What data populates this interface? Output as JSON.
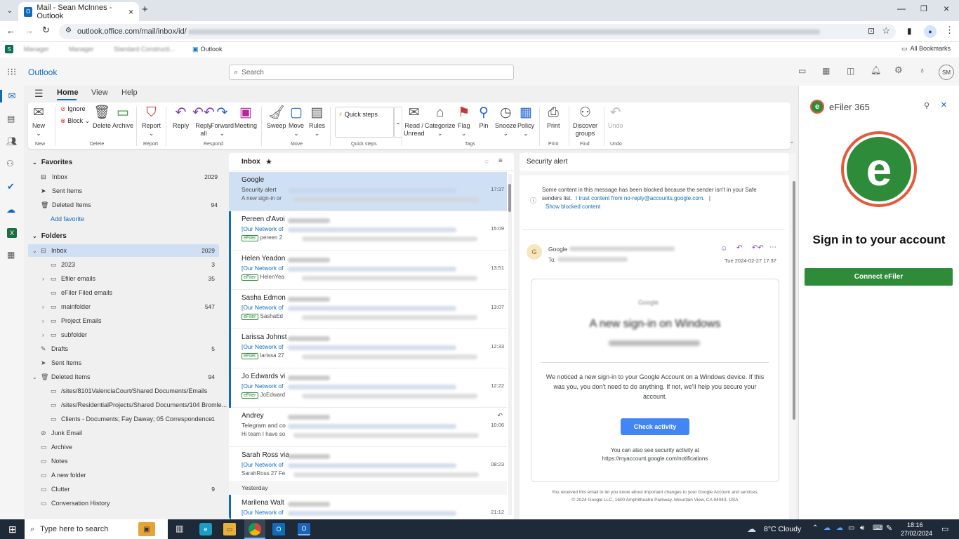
{
  "browser": {
    "tab_title": "Mail - Sean McInnes - Outlook",
    "url": "outlook.office.com/mail/inbox/id/",
    "bookmarks": [
      "Manager",
      "Manager",
      "Standard Constructi...",
      "Outlook"
    ],
    "all_bookmarks": "All Bookmarks",
    "profile_initials": "SM"
  },
  "app": {
    "name": "Outlook",
    "search_placeholder": "Search",
    "user_initials": "SM"
  },
  "ribbon": {
    "tabs": [
      "Home",
      "View",
      "Help"
    ],
    "buttons": {
      "new": "New",
      "ignore": "Ignore",
      "block": "Block",
      "delete": "Delete",
      "archive": "Archive",
      "report": "Report",
      "reply": "Reply",
      "reply_all_1": "Reply",
      "reply_all_2": "all",
      "forward": "Forward",
      "meeting": "Meeting",
      "sweep": "Sweep",
      "move": "Move",
      "rules": "Rules",
      "quick_steps": "Quick steps",
      "read_unread_1": "Read /",
      "read_unread_2": "Unread",
      "categorize": "Categorize",
      "flag": "Flag",
      "pin": "Pin",
      "snooze": "Snooze",
      "policy": "Policy",
      "print": "Print",
      "discover_1": "Discover",
      "discover_2": "groups",
      "undo": "Undo"
    },
    "groups": [
      "New",
      "Delete",
      "Report",
      "Respond",
      "Move",
      "Quick steps",
      "Tags",
      "Print",
      "Find",
      "Undo"
    ]
  },
  "folders": {
    "favorites_label": "Favorites",
    "favorites": [
      {
        "name": "Inbox",
        "count": "2029"
      },
      {
        "name": "Sent Items",
        "count": ""
      },
      {
        "name": "Deleted Items",
        "count": "94"
      }
    ],
    "add_favorite": "Add favorite",
    "folders_label": "Folders",
    "items": [
      {
        "name": "Inbox",
        "count": "2029"
      },
      {
        "name": "2023",
        "count": "3"
      },
      {
        "name": "Efiler emails",
        "count": "35"
      },
      {
        "name": "eFiler Filed emails",
        "count": ""
      },
      {
        "name": "mainfolder",
        "count": "547"
      },
      {
        "name": "Project Emails",
        "count": ""
      },
      {
        "name": "subfolder",
        "count": ""
      },
      {
        "name": "Drafts",
        "count": "5"
      },
      {
        "name": "Sent Items",
        "count": ""
      },
      {
        "name": "Deleted Items",
        "count": "94"
      },
      {
        "name": "/sites/8101ValenciaCourt/Shared Documents/Emails",
        "count": ""
      },
      {
        "name": "/sites/ResidentialProjects/Shared Documents/104 Bromle...",
        "count": ""
      },
      {
        "name": "Clients - Documents; Fay Daway; 05 Correspondence",
        "count": "1"
      },
      {
        "name": "Junk Email",
        "count": ""
      },
      {
        "name": "Archive",
        "count": ""
      },
      {
        "name": "Notes",
        "count": ""
      },
      {
        "name": "A new folder",
        "count": ""
      },
      {
        "name": "Clutter",
        "count": "9"
      },
      {
        "name": "Conversation History",
        "count": ""
      }
    ]
  },
  "message_list": {
    "title": "Inbox",
    "yesterday_label": "Yesterday",
    "messages": [
      {
        "sender": "Google",
        "subject": "Security alert",
        "preview": "A new sign-in or",
        "time": "17:37",
        "tag": ""
      },
      {
        "sender": "Pereen d'Avoi",
        "subject": "[Our Network of",
        "preview": "pereen 2",
        "time": "15:09",
        "tag": "eFiler"
      },
      {
        "sender": "Helen Yeadon",
        "subject": "[Our Network of",
        "preview": "HelenYea",
        "time": "13:51",
        "tag": "eFiler"
      },
      {
        "sender": "Sasha Edmon",
        "subject": "[Our Network of",
        "preview": "SashaEd",
        "time": "13:07",
        "tag": "eFiler"
      },
      {
        "sender": "Larissa Johnst",
        "subject": "[Our Network of",
        "preview": "larissa 27",
        "time": "12:33",
        "tag": "eFiler"
      },
      {
        "sender": "Jo Edwards vi",
        "subject": "[Our Network of",
        "preview": "JoEdward",
        "time": "12:22",
        "tag": "eFiler"
      },
      {
        "sender": "Andrey",
        "subject": "Telegram and co",
        "preview": "Hi team I have so",
        "time": "10:06",
        "tag": ""
      },
      {
        "sender": "Sarah Ross via",
        "subject": "[Our Network of",
        "preview": "SarahRoss 27 Fe",
        "time": "08:23",
        "tag": ""
      },
      {
        "sender": "Marilena Walt",
        "subject": "[Our Network of",
        "preview": "",
        "time": "21:12",
        "tag": ""
      }
    ]
  },
  "reading": {
    "subject": "Security alert",
    "blocked_text_1": "Some content in this message has been blocked because the sender isn't in your Safe",
    "blocked_text_2": "senders list.",
    "trust_link": "I trust content from no-reply@accounts.google.com.",
    "pipe": "|",
    "show_blocked": "Show blocked content",
    "avatar_letter": "G",
    "sender_prefix": "Google",
    "to_label": "To:",
    "date": "Tue 2024-02-27 17:37",
    "body_logo_alt": "Google",
    "body_heading": "A new sign-in on Windows",
    "body_text": "We noticed a new sign-in to your Google Account on a Windows device. If this was you, you don't need to do anything. If not, we'll help you secure your account.",
    "check_button": "Check activity",
    "also_text": "You can also see security activity at",
    "also_link": "https://myaccount.google.com/notifications",
    "footer_1": "You received this email to let you know about important changes to your Google Account and services.",
    "footer_2": "© 2024 Google LLC, 1600 Amphitheatre Parkway, Mountain View, CA 94043, USA"
  },
  "addin": {
    "title": "eFiler 365",
    "heading": "Sign in to your account",
    "connect_button": "Connect eFiler",
    "brand_color": "#2e8b3a",
    "ring_color": "#e55a3c"
  },
  "taskbar": {
    "search_placeholder": "Type here to search",
    "weather": "8°C  Cloudy",
    "time": "18:16",
    "date": "27/02/2024"
  },
  "colors": {
    "accent": "#0f6cbd",
    "selected": "#cfe0f5",
    "efiler_green": "#2e8b3a"
  }
}
